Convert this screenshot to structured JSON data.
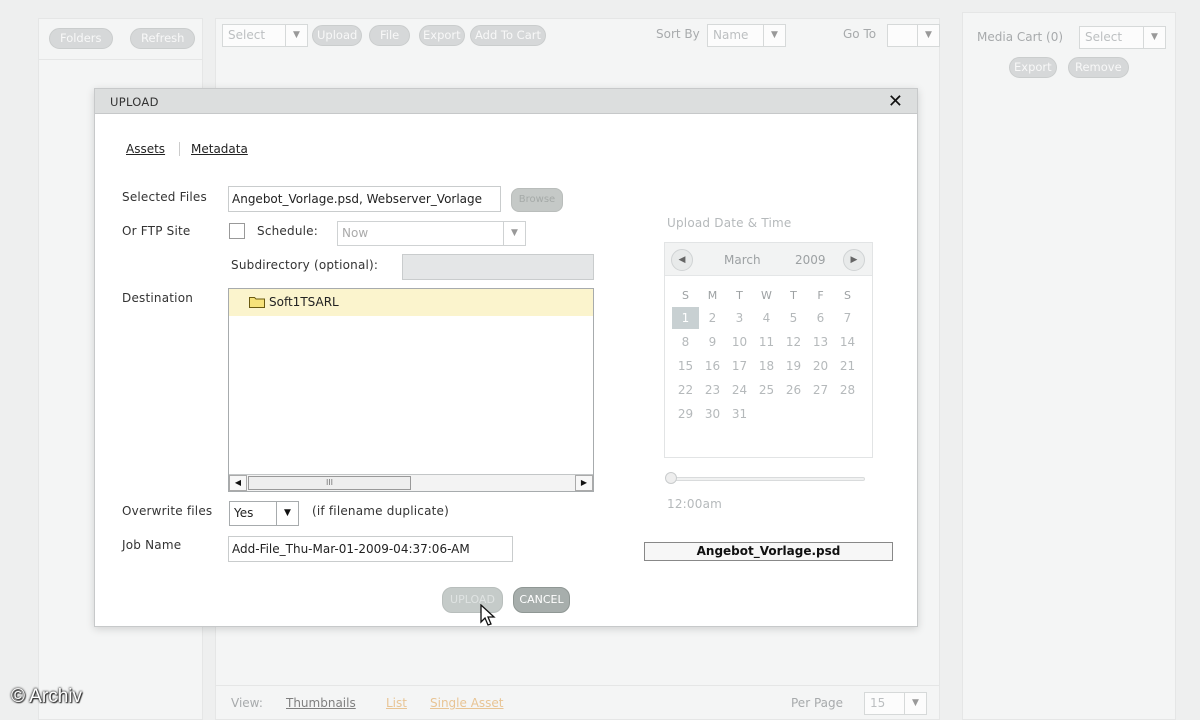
{
  "left_panel": {
    "folders_label": "Folders",
    "refresh_label": "Refresh"
  },
  "toolbar": {
    "select_value": "Select",
    "upload_label": "Upload",
    "file_label": "File",
    "export_label": "Export",
    "add_to_cart_label": "Add To Cart",
    "sort_by_label": "Sort By",
    "sort_by_value": "Name",
    "go_to_label": "Go To",
    "go_to_value": ""
  },
  "bottom_bar": {
    "view_label": "View:",
    "views": [
      "Thumbnails",
      "List",
      "Single Asset"
    ],
    "per_page_label": "Per Page",
    "per_page_value": "15"
  },
  "media_cart": {
    "label": "Media Cart (0)",
    "select_value": "Select",
    "export_label": "Export",
    "remove_label": "Remove"
  },
  "dialog": {
    "title": "UPLOAD",
    "close_symbol": "✕",
    "tabs": [
      "Assets",
      "Metadata"
    ],
    "selected_files_label": "Selected Files",
    "selected_files_value": "Angebot_Vorlage.psd, Webserver_Vorlage",
    "browse_label": "Browse",
    "ftp_label": "Or FTP Site",
    "schedule_label": "Schedule:",
    "schedule_value": "Now",
    "subdirectory_label": "Subdirectory (optional):",
    "subdirectory_value": "",
    "destination_label": "Destination",
    "destination_folder": "Soft1TSARL",
    "overwrite_label": "Overwrite files",
    "overwrite_value": "Yes",
    "overwrite_hint": "(if filename duplicate)",
    "job_name_label": "Job Name",
    "job_name_value": "Add-File_Thu-Mar-01-2009-04:37:06-AM",
    "upload_datetime_label": "Upload Date & Time",
    "calendar": {
      "month": "March",
      "year": "2009",
      "weekdays": [
        "S",
        "M",
        "T",
        "W",
        "T",
        "F",
        "S"
      ],
      "days": [
        [
          "1",
          "2",
          "3",
          "4",
          "5",
          "6",
          "7"
        ],
        [
          "8",
          "9",
          "10",
          "11",
          "12",
          "13",
          "14"
        ],
        [
          "15",
          "16",
          "17",
          "18",
          "19",
          "20",
          "21"
        ],
        [
          "22",
          "23",
          "24",
          "25",
          "26",
          "27",
          "28"
        ],
        [
          "29",
          "30",
          "31"
        ]
      ],
      "selected_day": "1"
    },
    "time_value": "12:00am",
    "time_slider_fraction": 0,
    "selected_file_name": "Angebot_Vorlage.psd",
    "upload_button": "UPLOAD",
    "cancel_button": "CANCEL",
    "scroll_thumb_label": "III"
  },
  "watermark": "© Archiv"
}
